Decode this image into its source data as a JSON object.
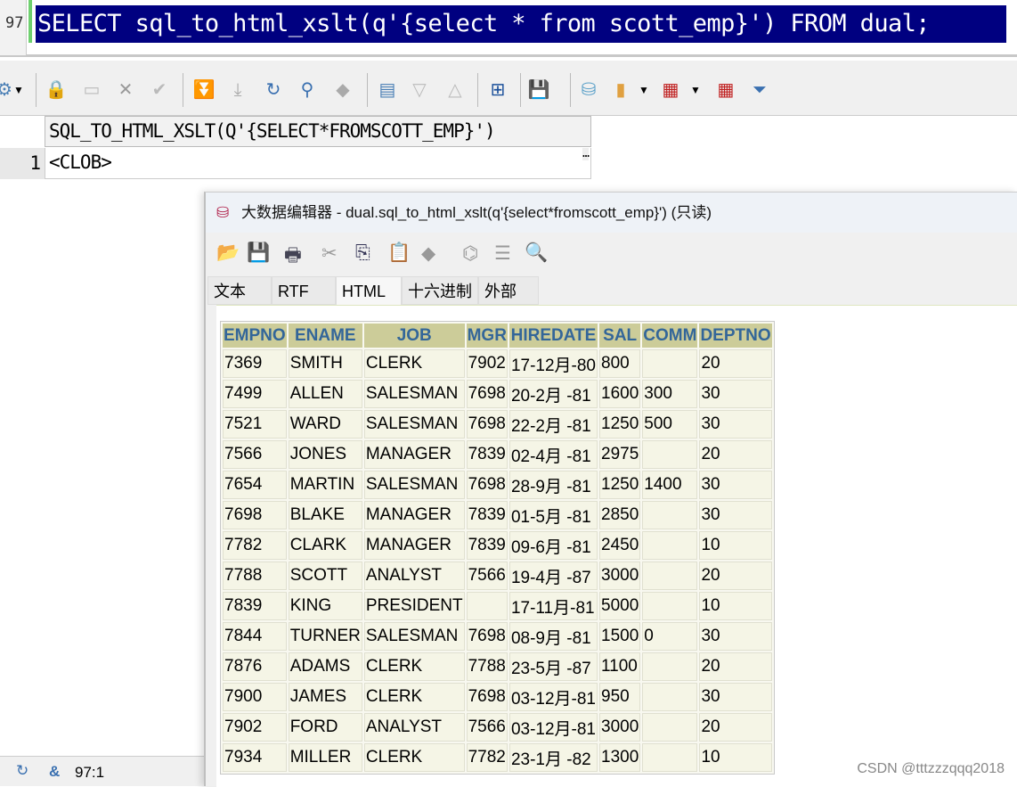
{
  "editor": {
    "line_number": "97",
    "sql": "SELECT sql_to_html_xslt(q'{select * from scott_emp}') FROM dual;"
  },
  "toolbar": {
    "icons": [
      "settings-icon",
      "dropdown-icon",
      "lock-icon",
      "insert-row-icon",
      "delete-row-icon",
      "commit-icon",
      "fetch-next-icon",
      "fetch-all-icon",
      "refresh-icon",
      "find-icon",
      "clear-icon",
      "detail-view-icon",
      "sort-desc-icon",
      "sort-asc-icon",
      "tree-icon",
      "save-icon",
      "export-db-icon",
      "chart-icon",
      "grid-icon",
      "grid-copy-icon",
      "filter-icon"
    ]
  },
  "result_grid": {
    "column_header": "SQL_TO_HTML_XSLT(Q'{SELECT*FROMSCOTT_EMP}')",
    "row_number": "1",
    "cell": "<CLOB>",
    "ellipsis": "…"
  },
  "status": {
    "ampersand": "&",
    "position": "97:1"
  },
  "dialog": {
    "title": "大数据编辑器 - dual.sql_to_html_xslt(q'{select*fromscott_emp}') (只读)",
    "tabs": [
      "文本",
      "RTF",
      "HTML",
      "十六进制",
      "外部"
    ],
    "active_tab": "HTML"
  },
  "emp_table": {
    "columns": [
      "EMPNO",
      "ENAME",
      "JOB",
      "MGR",
      "HIREDATE",
      "SAL",
      "COMM",
      "DEPTNO"
    ],
    "rows": [
      [
        "7369",
        "SMITH",
        "CLERK",
        "7902",
        "17-12月-80",
        "800",
        "",
        "20"
      ],
      [
        "7499",
        "ALLEN",
        "SALESMAN",
        "7698",
        "20-2月 -81",
        "1600",
        "300",
        "30"
      ],
      [
        "7521",
        "WARD",
        "SALESMAN",
        "7698",
        "22-2月 -81",
        "1250",
        "500",
        "30"
      ],
      [
        "7566",
        "JONES",
        "MANAGER",
        "7839",
        "02-4月 -81",
        "2975",
        "",
        "20"
      ],
      [
        "7654",
        "MARTIN",
        "SALESMAN",
        "7698",
        "28-9月 -81",
        "1250",
        "1400",
        "30"
      ],
      [
        "7698",
        "BLAKE",
        "MANAGER",
        "7839",
        "01-5月 -81",
        "2850",
        "",
        "30"
      ],
      [
        "7782",
        "CLARK",
        "MANAGER",
        "7839",
        "09-6月 -81",
        "2450",
        "",
        "10"
      ],
      [
        "7788",
        "SCOTT",
        "ANALYST",
        "7566",
        "19-4月 -87",
        "3000",
        "",
        "20"
      ],
      [
        "7839",
        "KING",
        "PRESIDENT",
        "",
        "17-11月-81",
        "5000",
        "",
        "10"
      ],
      [
        "7844",
        "TURNER",
        "SALESMAN",
        "7698",
        "08-9月 -81",
        "1500",
        "0",
        "30"
      ],
      [
        "7876",
        "ADAMS",
        "CLERK",
        "7788",
        "23-5月 -87",
        "1100",
        "",
        "20"
      ],
      [
        "7900",
        "JAMES",
        "CLERK",
        "7698",
        "03-12月-81",
        "950",
        "",
        "30"
      ],
      [
        "7902",
        "FORD",
        "ANALYST",
        "7566",
        "03-12月-81",
        "3000",
        "",
        "20"
      ],
      [
        "7934",
        "MILLER",
        "CLERK",
        "7782",
        "23-1月 -82",
        "1300",
        "",
        "10"
      ]
    ]
  },
  "watermark": "CSDN @tttzzzqqq2018"
}
